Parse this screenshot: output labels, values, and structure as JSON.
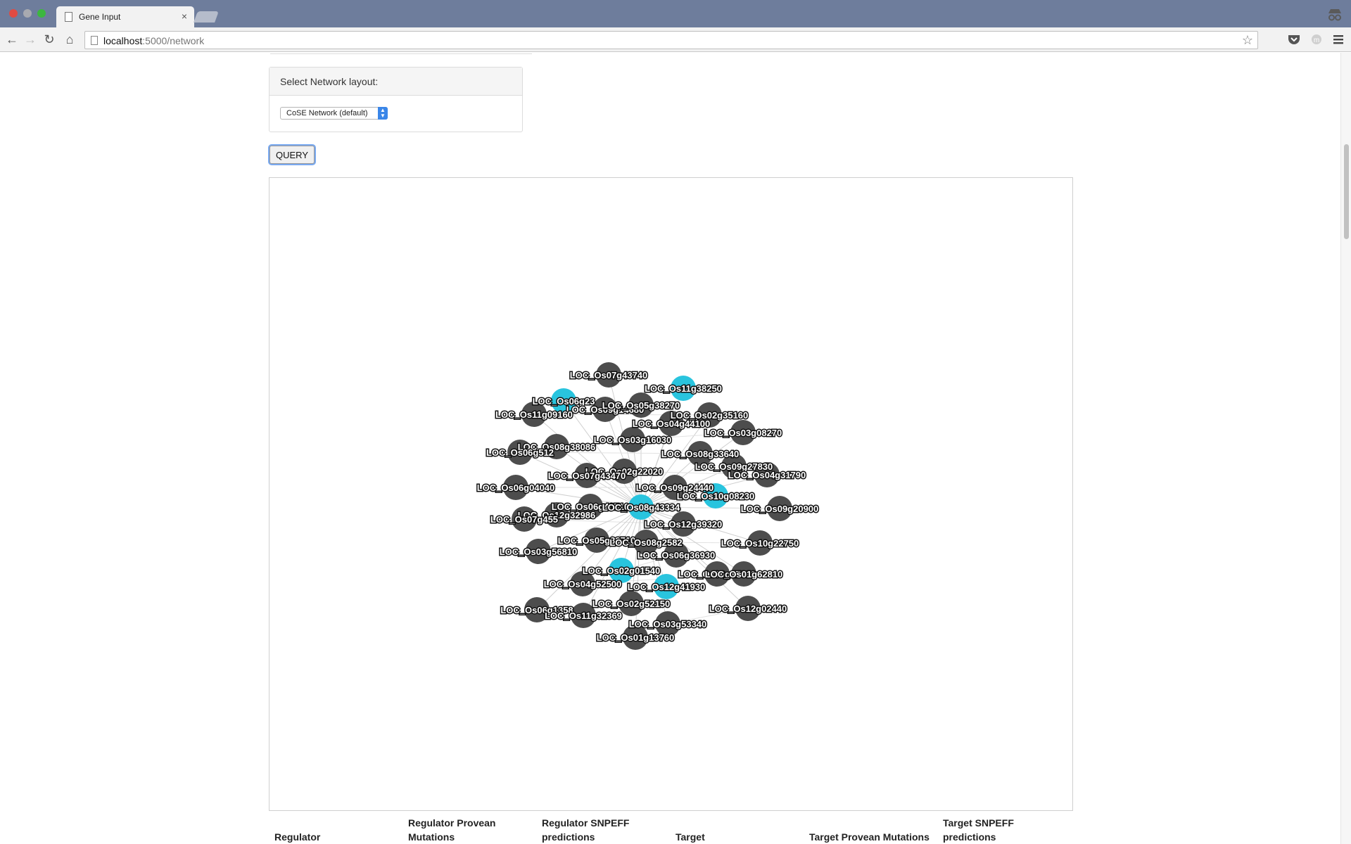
{
  "browser": {
    "tab_title": "Gene Input",
    "tab_close": "×",
    "url_host": "localhost",
    "url_path": ":5000/network",
    "nav": {
      "back": "←",
      "forward": "→",
      "reload": "↻",
      "home": "⌂"
    },
    "icons": [
      "page-icon",
      "star-icon",
      "pocket-icon",
      "extension-icon",
      "menu-icon",
      "incognito-icon"
    ]
  },
  "layout_panel": {
    "heading": "Select Network layout:",
    "selected": "CoSE Network (default)"
  },
  "query_button": "QUERY",
  "network": {
    "colors": {
      "node_regular": "#4d4d4d",
      "node_highlight": "#29c4de",
      "edge": "#cfcfcf"
    },
    "hub": {
      "label": "LOC_Os08g43334",
      "highlight": true
    },
    "nodes": [
      {
        "label": "LOC_Os07g43740",
        "highlight": false
      },
      {
        "label": "LOC_Os11g38250",
        "highlight": true
      },
      {
        "label": "LOC_Os06g23",
        "highlight": true
      },
      {
        "label": "LOC_Os09g14680",
        "highlight": false
      },
      {
        "label": "LOC_Os05g38270",
        "highlight": false
      },
      {
        "label": "LOC_Os11g09160",
        "highlight": false
      },
      {
        "label": "LOC_Os02g35160",
        "highlight": false
      },
      {
        "label": "LOC_Os04g44100",
        "highlight": false
      },
      {
        "label": "LOC_Os03g08270",
        "highlight": false
      },
      {
        "label": "LOC_Os03g16030",
        "highlight": false
      },
      {
        "label": "LOC_Os08g38086",
        "highlight": false
      },
      {
        "label": "LOC_Os06g512",
        "highlight": false
      },
      {
        "label": "LOC_Os08g33640",
        "highlight": false
      },
      {
        "label": "LOC_Os09g27830",
        "highlight": false
      },
      {
        "label": "LOC_Os04g31790",
        "highlight": false
      },
      {
        "label": "LOC_Os02g22020",
        "highlight": false
      },
      {
        "label": "LOC_Os07g43470",
        "highlight": false
      },
      {
        "label": "LOC_Os06g04040",
        "highlight": false
      },
      {
        "label": "LOC_Os09g24440",
        "highlight": false
      },
      {
        "label": "LOC_Os10g08230",
        "highlight": true
      },
      {
        "label": "LOC_Os09g20900",
        "highlight": false
      },
      {
        "label": "LOC_Os06g40710",
        "highlight": false
      },
      {
        "label": "LOC_Os12g32986",
        "highlight": false
      },
      {
        "label": "LOC_Os07g455",
        "highlight": false
      },
      {
        "label": "LOC_Os12g39320",
        "highlight": false
      },
      {
        "label": "LOC_Os05g38710",
        "highlight": false
      },
      {
        "label": "LOC_Os08g2582",
        "highlight": false
      },
      {
        "label": "LOC_Os10g22750",
        "highlight": false
      },
      {
        "label": "LOC_Os03g56810",
        "highlight": false
      },
      {
        "label": "LOC_Os06g36930",
        "highlight": false
      },
      {
        "label": "LOC_Os02g01540",
        "highlight": true
      },
      {
        "label": "LOC_Os08g17680",
        "highlight": false
      },
      {
        "label": "LOC_Os01g62810",
        "highlight": false
      },
      {
        "label": "LOC_Os04g52500",
        "highlight": false
      },
      {
        "label": "LOC_Os12g41930",
        "highlight": true
      },
      {
        "label": "LOC_Os02g52150",
        "highlight": false
      },
      {
        "label": "LOC_Os06g1358",
        "highlight": false
      },
      {
        "label": "LOC_Os11g32369",
        "highlight": false
      },
      {
        "label": "LOC_Os12g02440",
        "highlight": false
      },
      {
        "label": "LOC_Os03g53340",
        "highlight": false
      },
      {
        "label": "LOC_Os01g13760",
        "highlight": false
      }
    ]
  },
  "table": {
    "headers": [
      "Regulator",
      "Regulator Provean Mutations",
      "Regulator SNPEFF predictions",
      "Target",
      "Target Provean Mutations",
      "Target SNPEFF predictions"
    ]
  }
}
